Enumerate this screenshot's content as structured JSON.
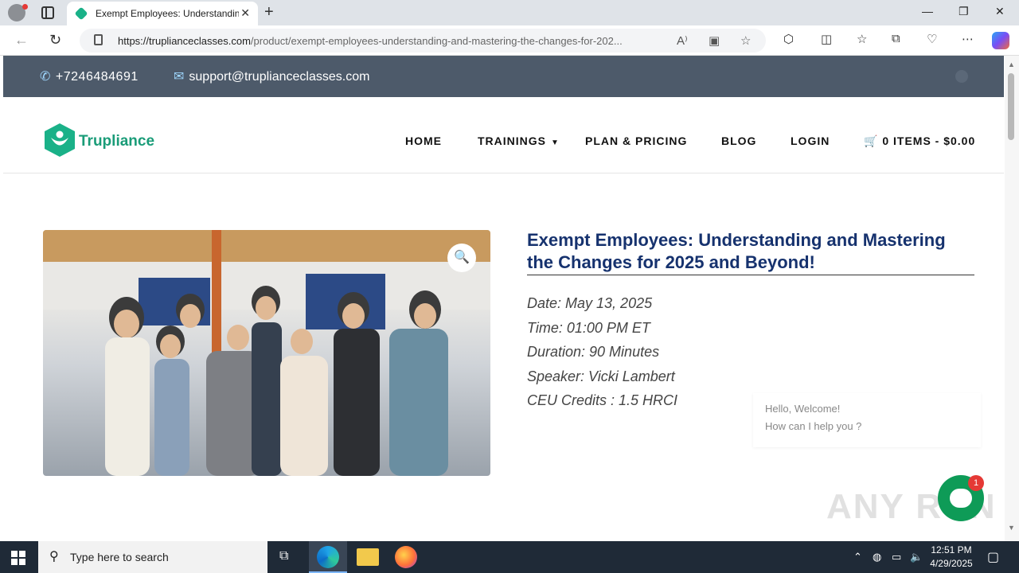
{
  "browser": {
    "tab_title": "Exempt Employees: Understanding",
    "url_domain": "https://truplianceclasses.com",
    "url_path": "/product/exempt-employees-understanding-and-mastering-the-changes-for-202..."
  },
  "topbar": {
    "phone": "+7246484691",
    "email": "support@truplianceclasses.com"
  },
  "header": {
    "logo_text": "Trupliance",
    "nav": [
      "HOME",
      "TRAININGS",
      "PLAN & PRICING",
      "BLOG",
      "LOGIN"
    ],
    "cart": "0 ITEMS - $0.00"
  },
  "product": {
    "title": "Exempt Employees: Understanding and Mastering the Changes for 2025 and Beyond!",
    "date": "Date: May 13, 2025",
    "time": "Time: 01:00 PM ET",
    "duration": "Duration: 90 Minutes",
    "speaker": "Speaker: Vicki Lambert",
    "ceu": "CEU Credits : 1.5 HRCI"
  },
  "chat": {
    "line1": "Hello, Welcome!",
    "line2": "How can I help you ?",
    "badge": "1"
  },
  "watermark": "ANY RUN",
  "taskbar": {
    "search_placeholder": "Type here to search",
    "time": "12:51 PM",
    "date": "4/29/2025"
  },
  "colors": {
    "topbar": "#4d5a6a",
    "title": "#16326e",
    "brand": "#1a9c78",
    "chat": "#0e9b57"
  }
}
